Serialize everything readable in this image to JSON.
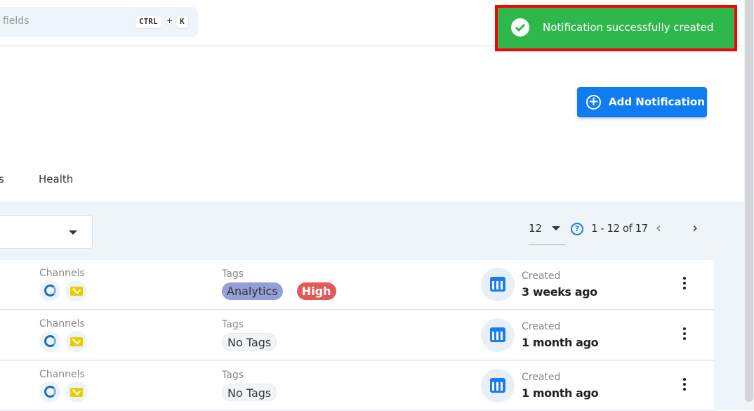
{
  "header": {
    "search_placeholder": "fields",
    "shortcut_key1": "CTRL",
    "shortcut_plus": "+",
    "shortcut_key2": "K"
  },
  "toast": {
    "message": "Notification successfully created",
    "icon": "check-circle-icon",
    "color": "#2eb84b"
  },
  "actions": {
    "add_label": "Add Notification"
  },
  "tabs": [
    {
      "label": "s"
    },
    {
      "label": "Health"
    }
  ],
  "pagination": {
    "per_page": "12",
    "range": "1 - 12 of 17"
  },
  "rows": [
    {
      "channels_label": "Channels",
      "tags_label": "Tags",
      "tags": [
        {
          "text": "Analytics",
          "color": "#949fd6"
        },
        {
          "text": "High",
          "color": "#e05a5a"
        }
      ],
      "created_label": "Created",
      "created": "3 weeks ago"
    },
    {
      "channels_label": "Channels",
      "tags_label": "Tags",
      "tags": [
        {
          "text": "No Tags"
        }
      ],
      "created_label": "Created",
      "created": "1 month ago"
    },
    {
      "channels_label": "Channels",
      "tags_label": "Tags",
      "tags": [
        {
          "text": "No Tags"
        }
      ],
      "created_label": "Created",
      "created": "1 month ago"
    }
  ]
}
